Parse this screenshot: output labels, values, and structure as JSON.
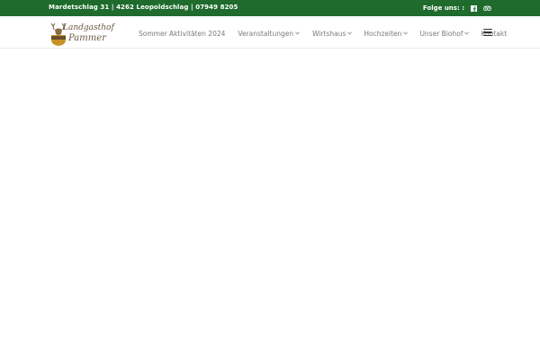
{
  "topbar": {
    "address": "Mardetschlag 31 | 4262 Leopoldschlag | 07949 8205",
    "follow_label": "Folge uns: :",
    "social": [
      {
        "icon": "facebook-icon"
      },
      {
        "icon": "tripadvisor-icon"
      }
    ]
  },
  "logo": {
    "line1": "Landgasthof",
    "line2": "Pammer",
    "badge": "PAMMER"
  },
  "menu": {
    "items": [
      {
        "label": "Sommer Aktivitäten 2024",
        "dropdown": false
      },
      {
        "label": "Veranstaltungen",
        "dropdown": true
      },
      {
        "label": "Wirtshaus",
        "dropdown": true
      },
      {
        "label": "Hochzeiten",
        "dropdown": true
      },
      {
        "label": "Unser Biohof",
        "dropdown": true
      },
      {
        "label": "Kontakt",
        "dropdown": false
      }
    ],
    "hamburger_icon": "hamburger-icon"
  },
  "colors": {
    "topbar_bg": "#1e6b2d",
    "menu_text": "#7a7a7a",
    "logo_text": "#6b5a40",
    "logo_accent": "#c8922a"
  }
}
